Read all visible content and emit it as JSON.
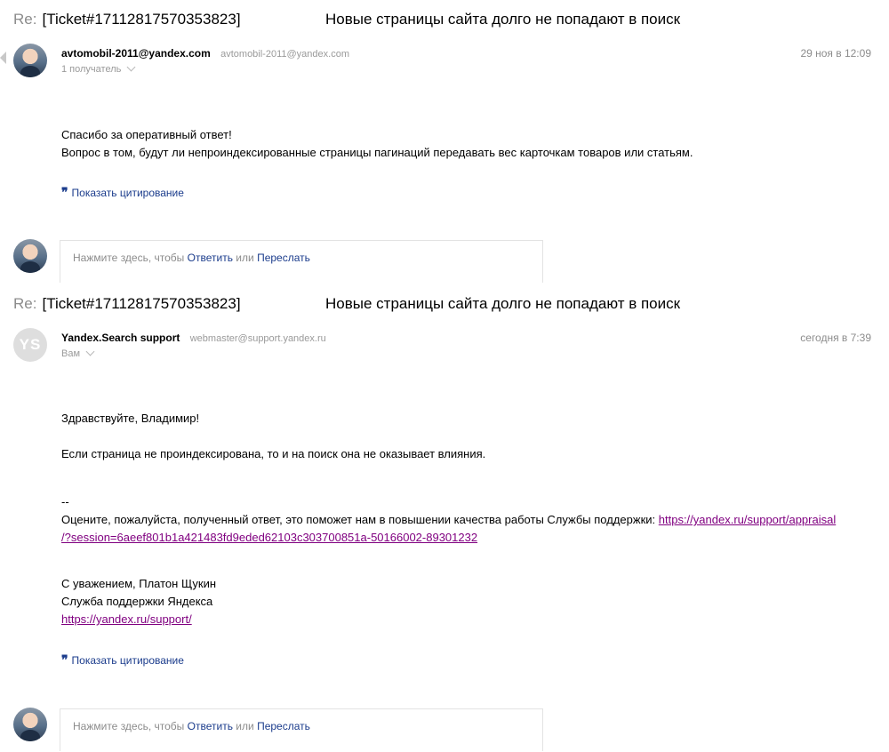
{
  "threads": [
    {
      "subject_re": "Re:",
      "subject_ticket": "[Ticket#17112817570353823]",
      "subject_title": "Новые страницы сайта долго не попадают в поиск",
      "sender_name": "avtomobil-2011@yandex.com",
      "sender_email": "avtomobil-2011@yandex.com",
      "recipients": "1 получатель",
      "date": "29 ноя в 12:09",
      "body": [
        "Спасибо за оперативный ответ!",
        "Вопрос в том, будут ли непроиндексированные страницы пагинаций передавать вес карточкам товаров или статьям."
      ],
      "show_quote": "Показать цитирование",
      "reply_prefix": "Нажмите здесь, чтобы",
      "reply_action": "Ответить",
      "reply_or": "или",
      "forward_action": "Переслать"
    },
    {
      "subject_re": "Re:",
      "subject_ticket": "[Ticket#17112817570353823]",
      "subject_title": "Новые страницы сайта долго не попадают в поиск",
      "sender_name": "Yandex.Search support",
      "sender_email": "webmaster@support.yandex.ru",
      "avatar_initials": "YS",
      "recipients": "Вам",
      "date": "сегодня в 7:39",
      "greeting": "Здравствуйте, Владимир!",
      "answer": "Если страница не проиндексирована, то и на поиск она не оказывает влияния.",
      "separator": "--",
      "rating_text": "Оцените, пожалуйста, полученный ответ, это поможет нам в повышении качества работы Службы поддержки:",
      "rating_link_1": "https://yandex.ru/support/appraisal",
      "rating_link_2": "/?session=6aeef801b1a421483fd9eded62103c303700851a-50166002-89301232",
      "signoff": "С уважением, Платон Щукин",
      "team": "Служба поддержки Яндекса",
      "support_link": "https://yandex.ru/support/",
      "show_quote": "Показать цитирование",
      "reply_prefix": "Нажмите здесь, чтобы",
      "reply_action": "Ответить",
      "reply_or": "или",
      "forward_action": "Переслать"
    }
  ],
  "colors": {
    "link_visited": "#800080",
    "action_blue": "#1b3c8c",
    "muted_gray": "#8c8c8c"
  },
  "icons": [
    "chevron-down-icon",
    "quote-icon",
    "collapse-arrow-icon"
  ]
}
